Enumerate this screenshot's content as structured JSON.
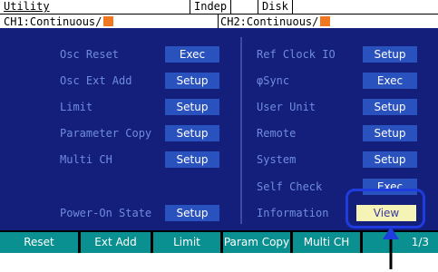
{
  "header": {
    "title": "Utility",
    "tab_indep": "Indep",
    "tab_disk": "Disk"
  },
  "channels": {
    "ch1": "CH1:Continuous/",
    "ch2": "CH2:Continuous/",
    "indicator_color": "#f07820"
  },
  "left_items": [
    {
      "label": "Osc Reset",
      "button": "Exec"
    },
    {
      "label": "Osc Ext Add",
      "button": "Setup"
    },
    {
      "label": "Limit",
      "button": "Setup"
    },
    {
      "label": "Parameter Copy",
      "button": "Setup"
    },
    {
      "label": "Multi CH",
      "button": "Setup"
    },
    {
      "label": "Power-On State",
      "button": "Setup"
    }
  ],
  "right_items": [
    {
      "label": "Ref Clock IO",
      "button": "Setup"
    },
    {
      "label": "φSync",
      "button": "Exec"
    },
    {
      "label": "User Unit",
      "button": "Setup"
    },
    {
      "label": "Remote",
      "button": "Setup"
    },
    {
      "label": "System",
      "button": "Setup"
    },
    {
      "label": "Self Check",
      "button": "Exec"
    },
    {
      "label": "Information",
      "button": "View"
    }
  ],
  "softkeys": [
    "Reset",
    "Ext Add",
    "Limit",
    "Param Copy",
    "Multi CH",
    "1/3"
  ],
  "colors": {
    "panel": "#141f7c",
    "button": "#2a52be",
    "label": "#6f8cdc",
    "softkey": "#0a9090",
    "highlight": "#1f3cde",
    "view_button": "#f6f3b6"
  }
}
